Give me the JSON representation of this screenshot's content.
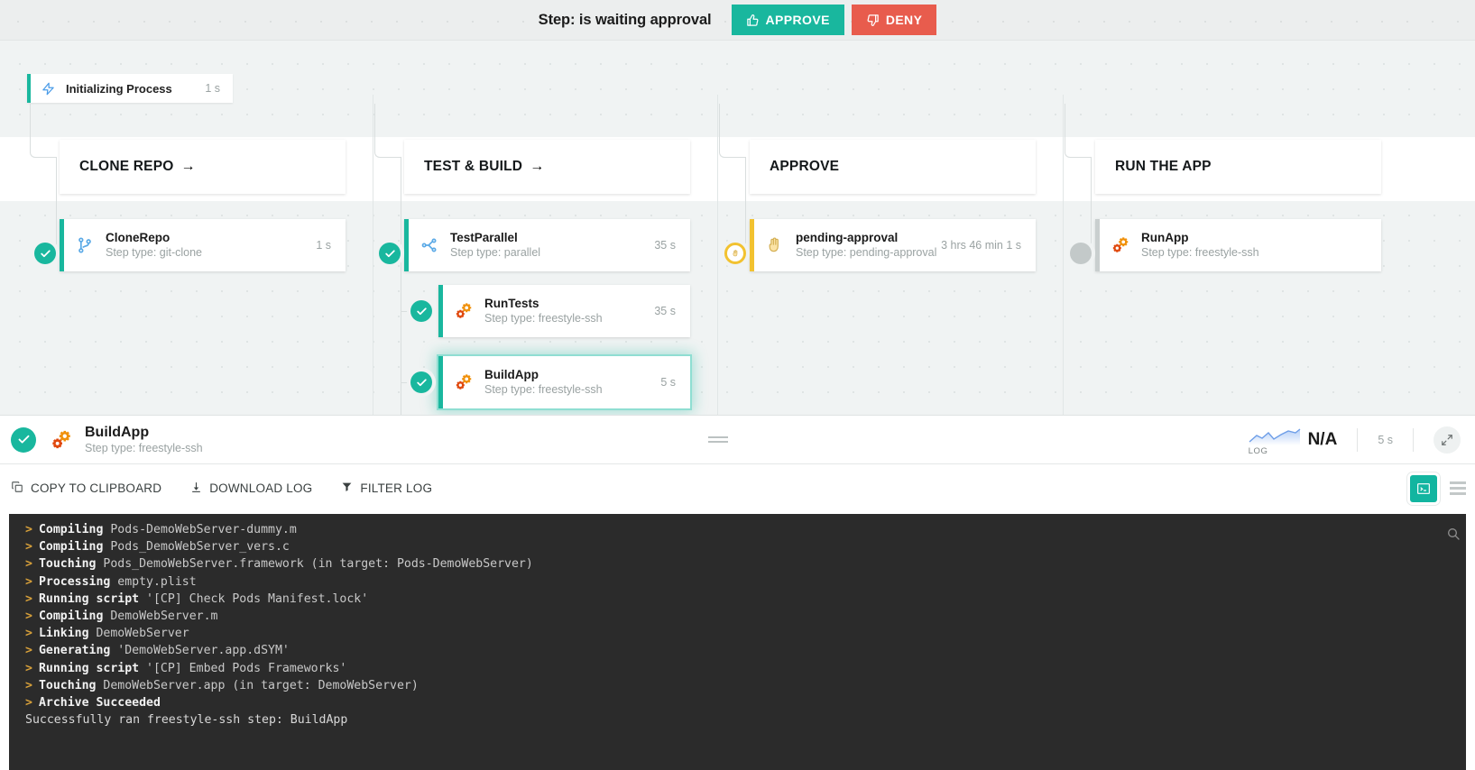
{
  "approval_bar": {
    "message": "Step: is waiting approval",
    "approve_label": "APPROVE",
    "deny_label": "DENY"
  },
  "init_step": {
    "name": "Initializing Process",
    "duration": "1 s"
  },
  "pipeline": {
    "columns": [
      {
        "phase_title": "CLONE REPO",
        "phase_arrow": "→",
        "steps": [
          {
            "name": "CloneRepo",
            "type": "Step type: git-clone",
            "duration": "1 s",
            "status": "success",
            "icon": "git-branch-icon"
          }
        ]
      },
      {
        "phase_title": "TEST & BUILD",
        "phase_arrow": "→",
        "steps": [
          {
            "name": "TestParallel",
            "type": "Step type: parallel",
            "duration": "35 s",
            "status": "success",
            "icon": "parallel-icon"
          },
          {
            "name": "RunTests",
            "type": "Step type: freestyle-ssh",
            "duration": "35 s",
            "status": "success",
            "icon": "gears-icon"
          },
          {
            "name": "BuildApp",
            "type": "Step type: freestyle-ssh",
            "duration": "5 s",
            "status": "success",
            "icon": "gears-icon"
          }
        ]
      },
      {
        "phase_title": "APPROVE",
        "phase_arrow": "",
        "steps": [
          {
            "name": "pending-approval",
            "type": "Step type: pending-approval",
            "duration": "3 hrs 46 min 1 s",
            "status": "pending",
            "icon": "hand-icon"
          }
        ]
      },
      {
        "phase_title": "RUN THE APP",
        "phase_arrow": "",
        "steps": [
          {
            "name": "RunApp",
            "type": "Step type: freestyle-ssh",
            "duration": "",
            "status": "idle",
            "icon": "gears-icon"
          }
        ]
      }
    ]
  },
  "detail": {
    "name": "BuildApp",
    "type": "Step type: freestyle-ssh",
    "sparkline_label": "LOG",
    "metric_value": "N/A",
    "duration": "5 s"
  },
  "log_toolbar": {
    "copy_label": "COPY TO CLIPBOARD",
    "download_label": "DOWNLOAD LOG",
    "filter_label": "FILTER LOG"
  },
  "console": {
    "lines": [
      {
        "prefix": ">",
        "verb": "Compiling",
        "arg": "Pods-DemoWebServer-dummy.m"
      },
      {
        "prefix": ">",
        "verb": "Compiling",
        "arg": "Pods_DemoWebServer_vers.c"
      },
      {
        "prefix": ">",
        "verb": "Touching",
        "arg": "Pods_DemoWebServer.framework (in target: Pods-DemoWebServer)"
      },
      {
        "prefix": ">",
        "verb": "Processing",
        "arg": "empty.plist"
      },
      {
        "prefix": ">",
        "verb": "Running script",
        "arg": "'[CP] Check Pods Manifest.lock'"
      },
      {
        "prefix": ">",
        "verb": "Compiling",
        "arg": "DemoWebServer.m"
      },
      {
        "prefix": ">",
        "verb": "Linking",
        "arg": "DemoWebServer"
      },
      {
        "prefix": ">",
        "verb": "Generating",
        "arg": "'DemoWebServer.app.dSYM'"
      },
      {
        "prefix": ">",
        "verb": "Running script",
        "arg": "'[CP] Embed Pods Frameworks'"
      },
      {
        "prefix": ">",
        "verb": "Touching",
        "arg": "DemoWebServer.app (in target: DemoWebServer)"
      },
      {
        "prefix": ">",
        "verb": "Archive Succeeded",
        "arg": ""
      },
      {
        "prefix": "",
        "verb": "",
        "arg": "Successfully ran freestyle-ssh step: BuildApp"
      }
    ]
  },
  "colors": {
    "success": "#19b79e",
    "pending": "#f2c230",
    "idle": "#c3c9c9",
    "deny": "#e85c4d",
    "console_bg": "#2b2b2b"
  }
}
